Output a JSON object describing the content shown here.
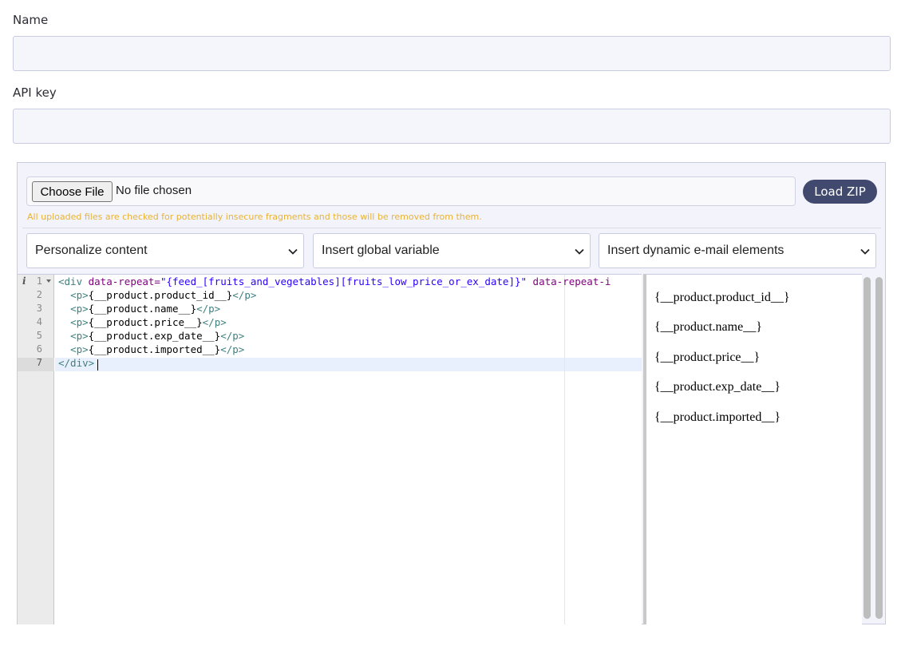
{
  "form": {
    "name_label": "Name",
    "name_value": "",
    "api_key_label": "API key",
    "api_key_value": ""
  },
  "upload": {
    "choose_file_label": "Choose File",
    "file_status": "No file chosen",
    "load_zip_label": "Load ZIP",
    "note": "All uploaded files are checked for potentially insecure fragments and those will be removed from them."
  },
  "selects": [
    {
      "value": "Personalize content"
    },
    {
      "value": "Insert global variable"
    },
    {
      "value": "Insert dynamic e-mail elements"
    }
  ],
  "code_editor": {
    "line_numbers": [
      "1",
      "2",
      "3",
      "4",
      "5",
      "6",
      "7"
    ],
    "active_line": "7",
    "lines": [
      {
        "tag_open": "<div",
        "attr1": " data-repeat=",
        "str1": "\"{feed_[fruits_and_vegetables][fruits_low_price_or_ex_date]}\"",
        "attr2": " data-repeat-i"
      },
      {
        "indent": "  ",
        "open": "<p>",
        "text": "{__product.product_id__}",
        "close": "</p>"
      },
      {
        "indent": "  ",
        "open": "<p>",
        "text": "{__product.name__}",
        "close": "</p>"
      },
      {
        "indent": "  ",
        "open": "<p>",
        "text": "{__product.price__}",
        "close": "</p>"
      },
      {
        "indent": "  ",
        "open": "<p>",
        "text": "{__product.exp_date__}",
        "close": "</p>"
      },
      {
        "indent": "  ",
        "open": "<p>",
        "text": "{__product.imported__}",
        "close": "</p>"
      },
      {
        "close": "</div>"
      }
    ]
  },
  "preview": {
    "lines": [
      "{__product.product_id__}",
      "{__product.name__}",
      "{__product.price__}",
      "{__product.exp_date__}",
      "{__product.imported__}"
    ]
  },
  "colors": {
    "accent_button": "#414a6e",
    "note_text": "#e8b234",
    "panel_bg": "#f3f4fb",
    "syntax_tag": "#3f7f7f",
    "syntax_attr": "#7f007f",
    "syntax_string": "#2a00ff"
  }
}
